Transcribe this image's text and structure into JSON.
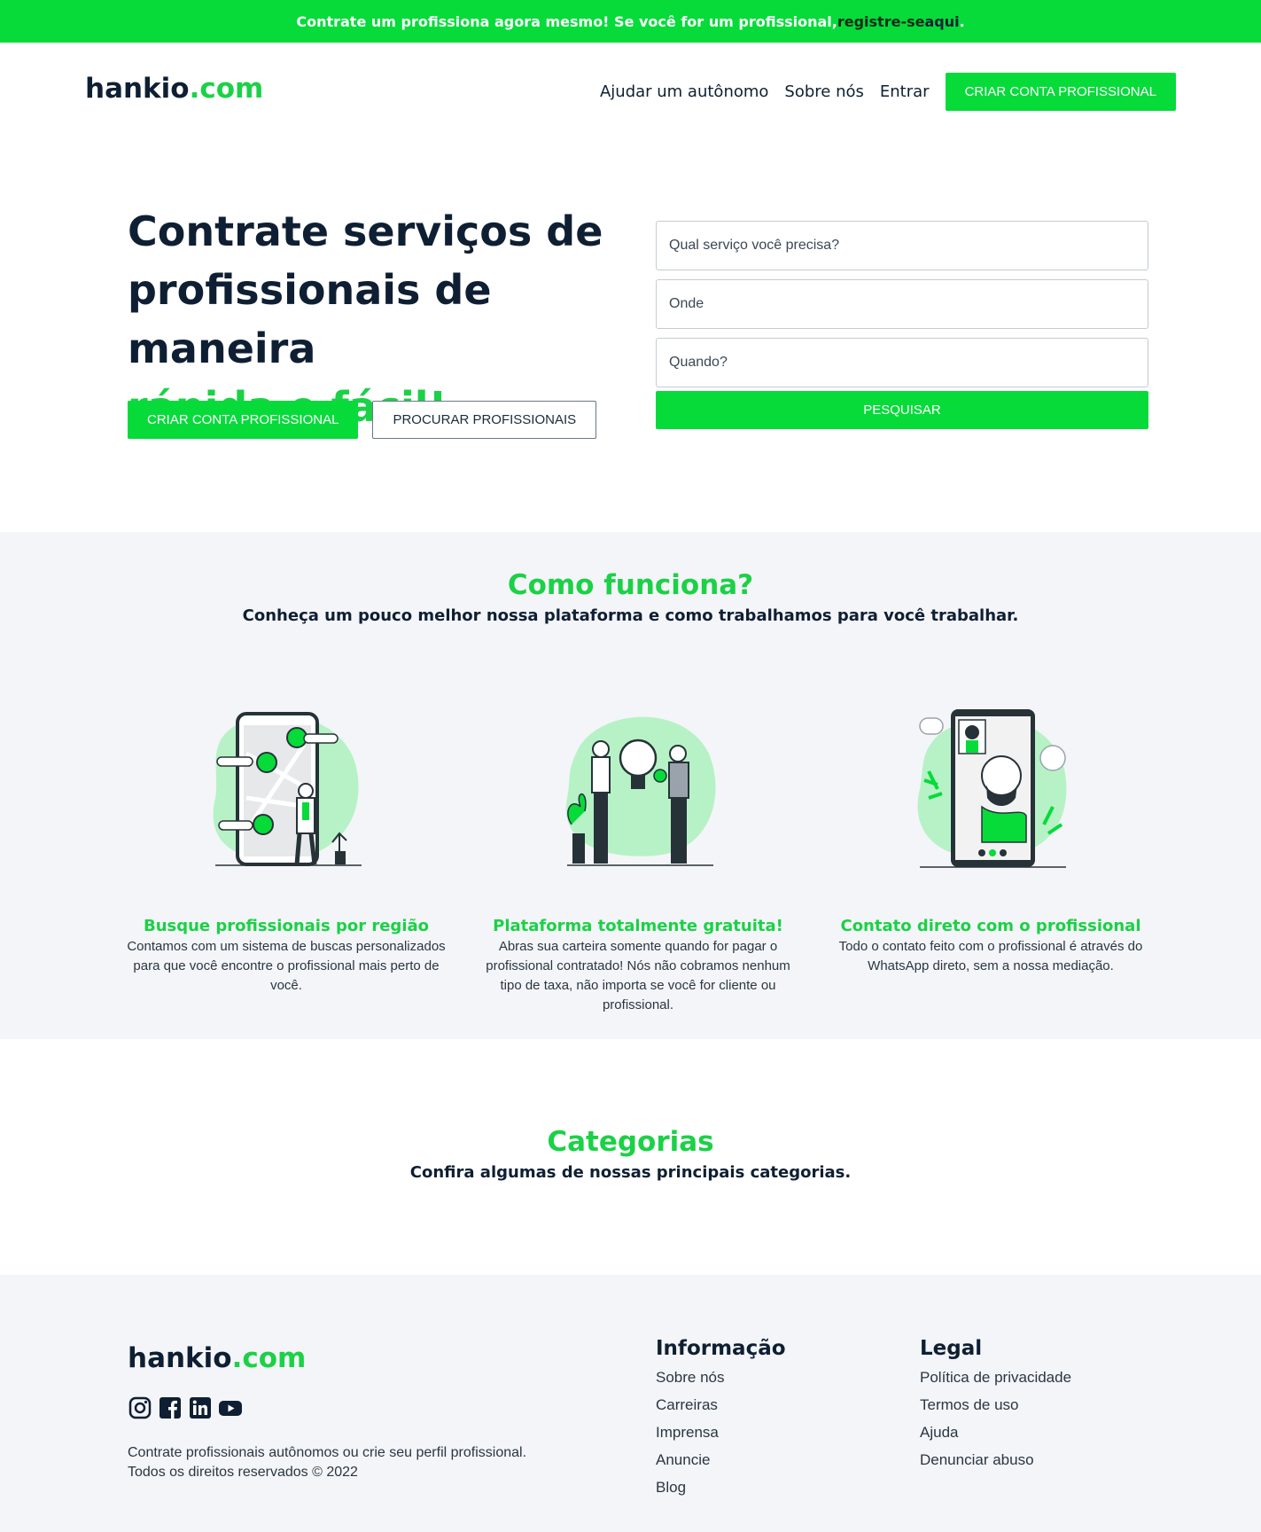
{
  "announcement": {
    "text": "Contrate um profissiona agora mesmo! Se você for um profissional, ",
    "link_part1": "registre-se ",
    "link_part2": "aqui",
    "end": "."
  },
  "header": {
    "logo_main": "hankio",
    "logo_suffix": ".com",
    "nav": [
      "Ajudar um autônomo",
      "Sobre nós",
      "Entrar"
    ],
    "cta": "CRIAR CONTA PROFISSIONAL"
  },
  "hero": {
    "title_line1": "Contrate serviços de",
    "title_line2": "profissionais de maneira",
    "title_accent": "rápida e fácil!",
    "primary_cta": "CRIAR CONTA PROFISSIONAL",
    "secondary_cta": "PROCURAR PROFISSIONAIS"
  },
  "search": {
    "service_placeholder": "Qual serviço você precisa?",
    "where_placeholder": "Onde",
    "when_placeholder": "Quando?",
    "submit": "PESQUISAR"
  },
  "how": {
    "title": "Como funciona?",
    "subtitle": "Conheça um pouco melhor nossa plataforma e como trabalhamos para você trabalhar.",
    "features": [
      {
        "title": "Busque profissionais por região",
        "text": "Contamos com um sistema de buscas personalizados para que você encontre o profissional mais perto de você."
      },
      {
        "title": "Plataforma totalmente gratuita!",
        "text": "Abras sua carteira somente quando for pagar o profissional contratado! Nós não cobramos nenhum tipo de taxa, não importa se você for cliente ou profissional."
      },
      {
        "title": "Contato direto com o profissional",
        "text": "Todo o contato feito com o profissional é através do WhatsApp direto, sem a nossa mediação."
      }
    ]
  },
  "categories": {
    "title": "Categorias",
    "subtitle": "Confira algumas de nossas principais categorias."
  },
  "footer": {
    "logo_main": "hankio",
    "logo_suffix": ".com",
    "socials": [
      "instagram-icon",
      "facebook-icon",
      "linkedin-icon",
      "youtube-icon"
    ],
    "copy_line1": "Contrate profissionais autônomos ou crie seu perfil profissional.",
    "copy_line2": "Todos os direitos reservados © 2022",
    "info": {
      "title": "Informação",
      "links": [
        "Sobre nós",
        "Carreiras",
        "Imprensa",
        "Anuncie",
        "Blog"
      ]
    },
    "legal": {
      "title": "Legal",
      "links": [
        "Política de privacidade",
        "Termos de uso",
        "Ajuda",
        "Denunciar abuso"
      ]
    }
  },
  "colors": {
    "brand_green": "#06db3a",
    "text_green": "#1bd146",
    "navy": "#0f1f33",
    "light_bg": "#f4f5f8"
  }
}
